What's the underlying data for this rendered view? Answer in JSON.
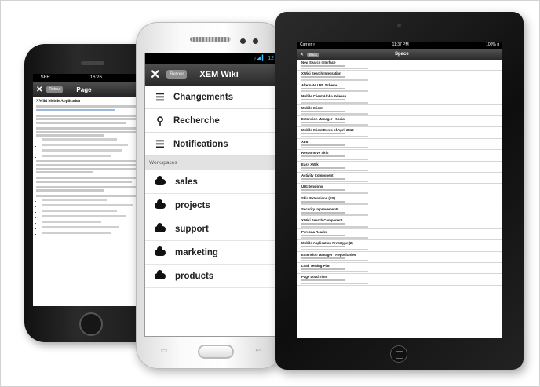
{
  "iphone": {
    "status": {
      "carrier": "... SFR",
      "time": "16:26",
      "battery": "✱ ▮"
    },
    "nav": {
      "close": "✕",
      "back_label": "Retour",
      "title": "Page",
      "edit_label": "▸"
    },
    "content": {
      "heading": "XWiki Mobile Application"
    }
  },
  "android": {
    "status": {
      "icons": "▿◢ ▎ 12"
    },
    "nav": {
      "close": "✕",
      "back_label": "Retour",
      "title": "XEM Wiki"
    },
    "menu": [
      {
        "icon": "☰",
        "label": "Changements"
      },
      {
        "icon": "⚲",
        "label": "Recherche"
      },
      {
        "icon": "☰",
        "label": "Notifications"
      }
    ],
    "section_label": "Workspaces",
    "workspaces": [
      {
        "label": "sales"
      },
      {
        "label": "projects"
      },
      {
        "label": "support"
      },
      {
        "label": "marketing"
      },
      {
        "label": "products"
      }
    ]
  },
  "ipad": {
    "status": {
      "carrier": "Carrier ▿",
      "time": "11:37 PM",
      "battery": "100% ▮"
    },
    "nav": {
      "close": "✕",
      "back_label": "Back",
      "title": "Space"
    },
    "rows": [
      {
        "title": "New Search Interface"
      },
      {
        "title": "XWiki Search Integration"
      },
      {
        "title": "Alternate URL Scheme"
      },
      {
        "title": "Mobile Client Alpha Release"
      },
      {
        "title": "Mobile Client"
      },
      {
        "title": "Extension Manager - Social"
      },
      {
        "title": "Mobile Client Demo of April 2012"
      },
      {
        "title": "XEM"
      },
      {
        "title": "Responsive Skin"
      },
      {
        "title": "Easy XWiki"
      },
      {
        "title": "Activity Component"
      },
      {
        "title": "UIExtensions"
      },
      {
        "title": "Skin Extensions (SX)"
      },
      {
        "title": "Security Improvements"
      },
      {
        "title": "XWiki Search Component"
      },
      {
        "title": "Persona Reader"
      },
      {
        "title": "Mobile Application Prototype (2)"
      },
      {
        "title": "Extension Manager - Repositories"
      },
      {
        "title": "Load Testing Plan"
      },
      {
        "title": "Page Load Time"
      }
    ]
  }
}
